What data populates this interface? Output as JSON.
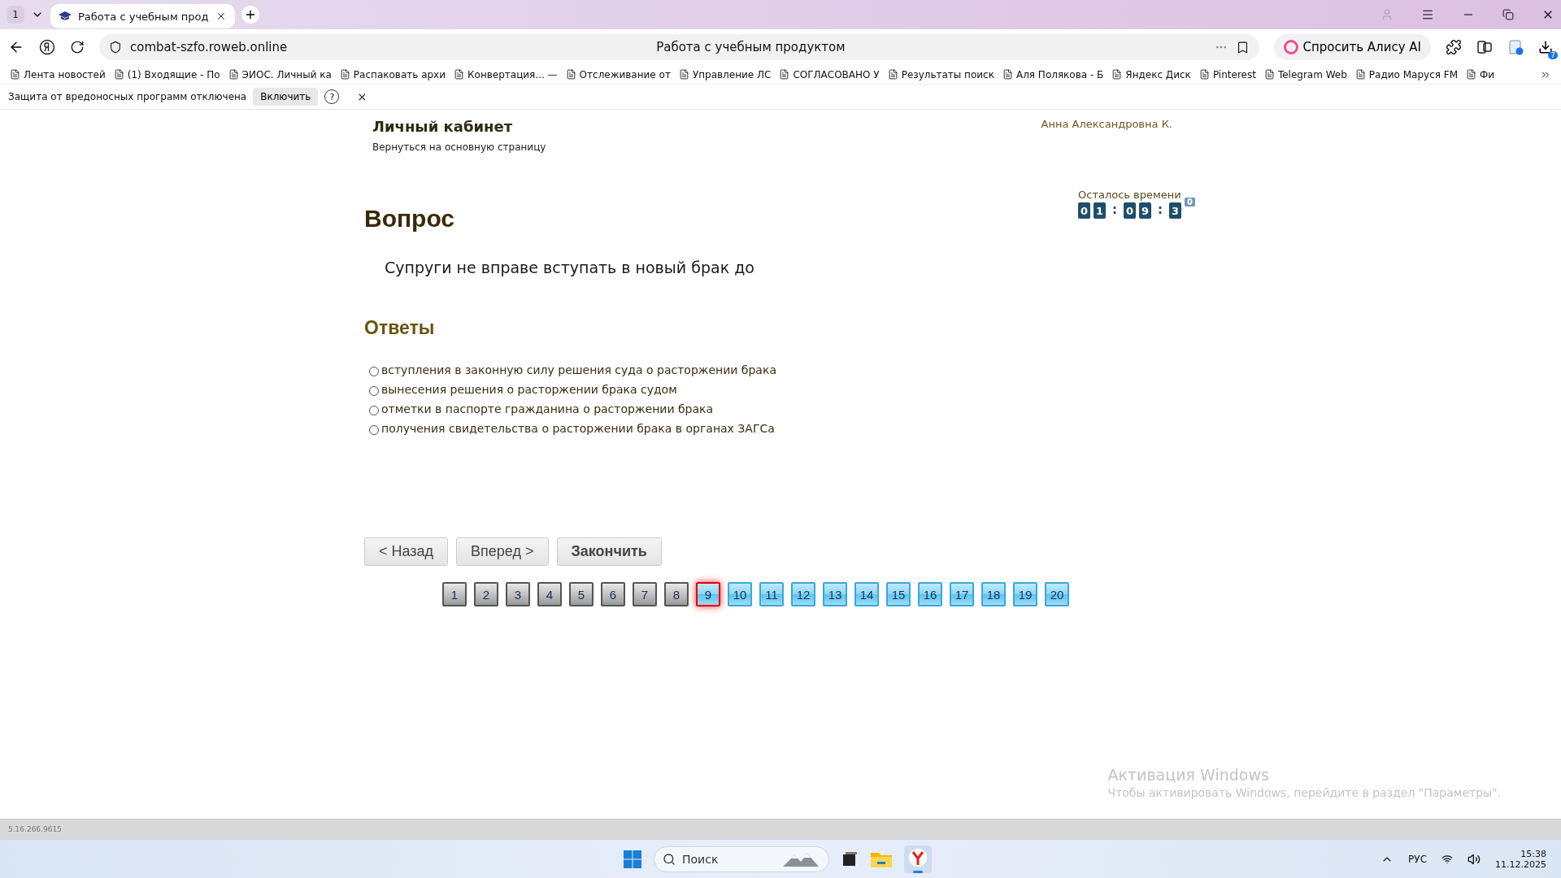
{
  "browser": {
    "tab_count": "1",
    "tab_title": "Работа с учебным прод",
    "address": "combat-szfo.roweb.online",
    "page_title": "Работа с учебным продуктом",
    "alice": "Спросить Алису AI",
    "downloads_badge": "7",
    "bookmarks": [
      {
        "label": "Лента новостей"
      },
      {
        "label": "(1) Входящие - По"
      },
      {
        "label": "ЭИОС. Личный ка"
      },
      {
        "label": "Распаковать архи"
      },
      {
        "label": "Конвертация... —"
      },
      {
        "label": "Отслеживание от"
      },
      {
        "label": "Управление ЛС"
      },
      {
        "label": "СОГЛАСОВАНО У"
      },
      {
        "label": "Результаты поиск"
      },
      {
        "label": "Аля Полякова - Б"
      },
      {
        "label": "Яндекс Диск"
      },
      {
        "label": "Pinterest"
      },
      {
        "label": "Telegram Web"
      },
      {
        "label": "Радио Маруся FM"
      },
      {
        "label": "Фи"
      }
    ],
    "notice": {
      "text": "Защита от вредоносных программ отключена",
      "button": "Включить",
      "help": "?",
      "close": "×"
    }
  },
  "header": {
    "title": "Личный кабинет",
    "back_link": "Вернуться на основную страницу",
    "user": "Анна Александровна К."
  },
  "timer": {
    "label": "Осталось времени",
    "cells": [
      {
        "kind": "digit",
        "text": "0"
      },
      {
        "kind": "digit",
        "text": "1"
      },
      {
        "kind": "separator",
        "text": ":"
      },
      {
        "kind": "digit",
        "text": "0"
      },
      {
        "kind": "digit",
        "text": "9"
      },
      {
        "kind": "separator",
        "text": ":"
      },
      {
        "kind": "digit",
        "text": "3"
      },
      {
        "kind": "rolling",
        "text": "0"
      }
    ]
  },
  "question": {
    "heading": "Вопрос",
    "text": "Супруги не вправе вступать в новый брак до"
  },
  "answers": {
    "heading": "Ответы",
    "options": [
      {
        "label": "вступления в законную силу решения суда о расторжении брака",
        "checked": false
      },
      {
        "label": "вынесения решения о расторжении брака судом",
        "checked": false
      },
      {
        "label": "отметки в паспорте гражданина о расторжении брака",
        "checked": false
      },
      {
        "label": "получения свидетельства о расторжении брака в органах ЗАГСа",
        "checked": false
      }
    ]
  },
  "nav_buttons": [
    {
      "label": "< Назад",
      "bold": false
    },
    {
      "label": "Вперед >",
      "bold": false
    },
    {
      "label": "Закончить",
      "bold": true
    }
  ],
  "pages": [
    {
      "label": "1",
      "visited": true,
      "selected": false
    },
    {
      "label": "2",
      "visited": true,
      "selected": false
    },
    {
      "label": "3",
      "visited": true,
      "selected": false
    },
    {
      "label": "4",
      "visited": true,
      "selected": false
    },
    {
      "label": "5",
      "visited": true,
      "selected": false
    },
    {
      "label": "6",
      "visited": true,
      "selected": false
    },
    {
      "label": "7",
      "visited": true,
      "selected": false
    },
    {
      "label": "8",
      "visited": true,
      "selected": false
    },
    {
      "label": "9",
      "visited": false,
      "selected": true
    },
    {
      "label": "10",
      "visited": false,
      "selected": false
    },
    {
      "label": "11",
      "visited": false,
      "selected": false
    },
    {
      "label": "12",
      "visited": false,
      "selected": false
    },
    {
      "label": "13",
      "visited": false,
      "selected": false
    },
    {
      "label": "14",
      "visited": false,
      "selected": false
    },
    {
      "label": "15",
      "visited": false,
      "selected": false
    },
    {
      "label": "16",
      "visited": false,
      "selected": false
    },
    {
      "label": "17",
      "visited": false,
      "selected": false
    },
    {
      "label": "18",
      "visited": false,
      "selected": false
    },
    {
      "label": "19",
      "visited": false,
      "selected": false
    },
    {
      "label": "20",
      "visited": false,
      "selected": false
    }
  ],
  "activation": {
    "title": "Активация Windows",
    "text": "Чтобы активировать Windows, перейдите в раздел \"Параметры\"."
  },
  "status_bar": {
    "version": "5.16.266.9615"
  },
  "taskbar": {
    "search": "Поиск",
    "language": "РУС",
    "time": "15:38",
    "date": "11.12.2025"
  }
}
